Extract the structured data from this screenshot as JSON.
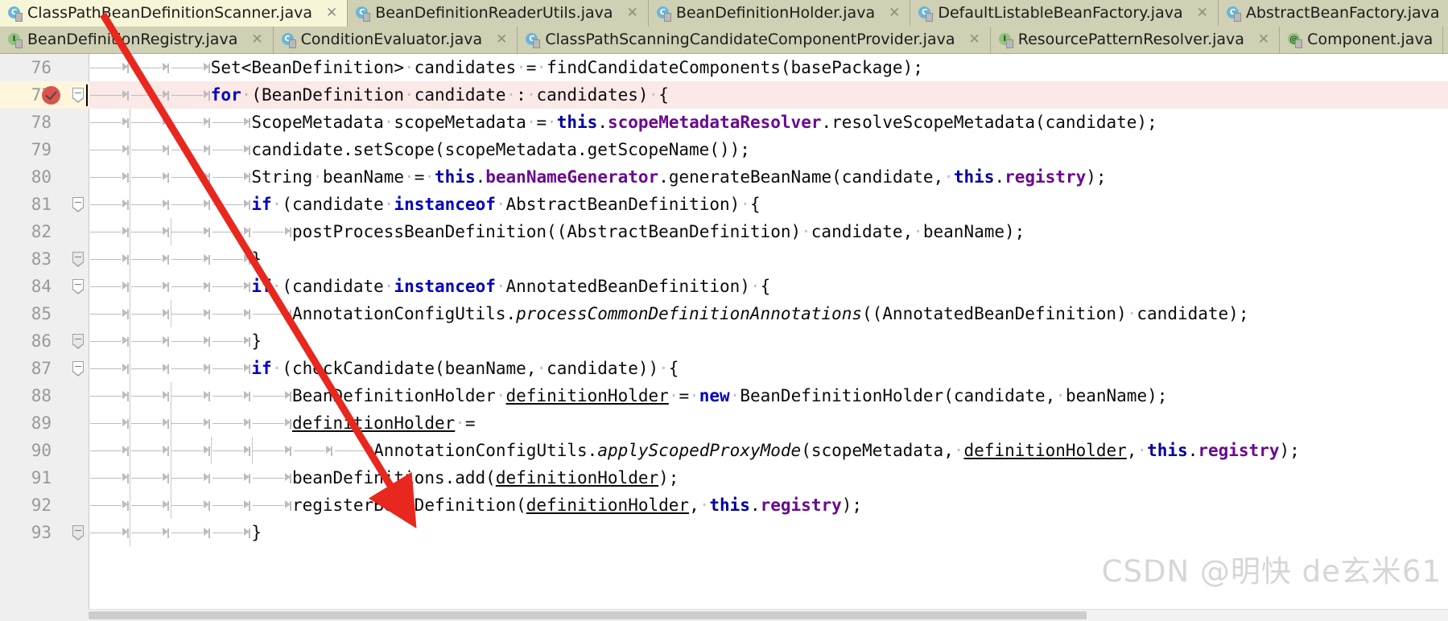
{
  "window": {
    "kind": "java-ide-editor"
  },
  "tabs": {
    "row1": [
      {
        "label": "ClassPathBeanDefinitionScanner.java",
        "icon": "java-class-icon",
        "icon_letter": "C",
        "active": true,
        "close": "✕"
      },
      {
        "label": "BeanDefinitionReaderUtils.java",
        "icon": "java-class-icon",
        "icon_letter": "C",
        "active": false,
        "close": "✕"
      },
      {
        "label": "BeanDefinitionHolder.java",
        "icon": "java-class-icon",
        "icon_letter": "C",
        "active": false,
        "close": "✕"
      },
      {
        "label": "DefaultListableBeanFactory.java",
        "icon": "java-class-icon",
        "icon_letter": "C",
        "active": false,
        "close": "✕"
      },
      {
        "label": "AbstractBeanFactory.java",
        "icon": "java-class-icon",
        "icon_letter": "C",
        "active": false,
        "close": ""
      }
    ],
    "row2": [
      {
        "label": "BeanDefinitionRegistry.java",
        "icon": "java-interface-icon",
        "icon_letter": "I",
        "active": false,
        "close": "✕"
      },
      {
        "label": "ConditionEvaluator.java",
        "icon": "java-class-icon",
        "icon_letter": "C",
        "active": false,
        "close": "✕"
      },
      {
        "label": "ClassPathScanningCandidateComponentProvider.java",
        "icon": "java-class-icon",
        "icon_letter": "C",
        "active": false,
        "close": "✕"
      },
      {
        "label": "ResourcePatternResolver.java",
        "icon": "java-interface-icon",
        "icon_letter": "I",
        "active": false,
        "close": "✕"
      },
      {
        "label": "Component.java",
        "icon": "java-annotation-icon",
        "icon_letter": "@",
        "active": false,
        "close": ""
      }
    ]
  },
  "editor": {
    "line_numbers": [
      "76",
      "77",
      "78",
      "79",
      "80",
      "81",
      "82",
      "83",
      "84",
      "85",
      "86",
      "87",
      "88",
      "89",
      "90",
      "91",
      "92",
      "93"
    ],
    "lines": [
      {
        "n": "76",
        "text": "Set<BeanDefinition> candidates = findCandidateComponents(basePackage);"
      },
      {
        "n": "77",
        "text": "for (BeanDefinition candidate : candidates) {"
      },
      {
        "n": "78",
        "text": "ScopeMetadata scopeMetadata = this.scopeMetadataResolver.resolveScopeMetadata(candidate);"
      },
      {
        "n": "79",
        "text": "candidate.setScope(scopeMetadata.getScopeName());"
      },
      {
        "n": "80",
        "text": "String beanName = this.beanNameGenerator.generateBeanName(candidate, this.registry);"
      },
      {
        "n": "81",
        "text": "if (candidate instanceof AbstractBeanDefinition) {"
      },
      {
        "n": "82",
        "text": "postProcessBeanDefinition((AbstractBeanDefinition) candidate, beanName);"
      },
      {
        "n": "83",
        "text": "}"
      },
      {
        "n": "84",
        "text": "if (candidate instanceof AnnotatedBeanDefinition) {"
      },
      {
        "n": "85",
        "text": "AnnotationConfigUtils.processCommonDefinitionAnnotations((AnnotatedBeanDefinition) candidate);"
      },
      {
        "n": "86",
        "text": "}"
      },
      {
        "n": "87",
        "text": "if (checkCandidate(beanName, candidate)) {"
      },
      {
        "n": "88",
        "text": "BeanDefinitionHolder definitionHolder = new BeanDefinitionHolder(candidate, beanName);"
      },
      {
        "n": "89",
        "text": "definitionHolder ="
      },
      {
        "n": "90",
        "text": "AnnotationConfigUtils.applyScopedProxyMode(scopeMetadata, definitionHolder, this.registry);"
      },
      {
        "n": "91",
        "text": "beanDefinitions.add(definitionHolder);"
      },
      {
        "n": "92",
        "text": "registerBeanDefinition(definitionHolder, this.registry);"
      },
      {
        "n": "93",
        "text": "}"
      }
    ],
    "gutter_icon": "run-check-icon",
    "gutter_icon_line": "77",
    "caret_line": "77"
  },
  "watermark": {
    "text": "CSDN @明快 de玄米61"
  },
  "annotation": {
    "type": "red-arrow",
    "color": "#e8271e"
  },
  "colors": {
    "tab_active_bg": "#f7f5d8",
    "tab_inactive_bg": "#cfd0b4",
    "gutter_bg": "#efefef",
    "highlight_row_bg": "#fbe9e7",
    "highlight_gutter_bg": "#fdf6dd",
    "keyword": "#0000c0",
    "this_keyword": "#0000a0",
    "field": "#6a0a8f",
    "watermark": "#d6d6d6",
    "arrow": "#e8271e"
  }
}
